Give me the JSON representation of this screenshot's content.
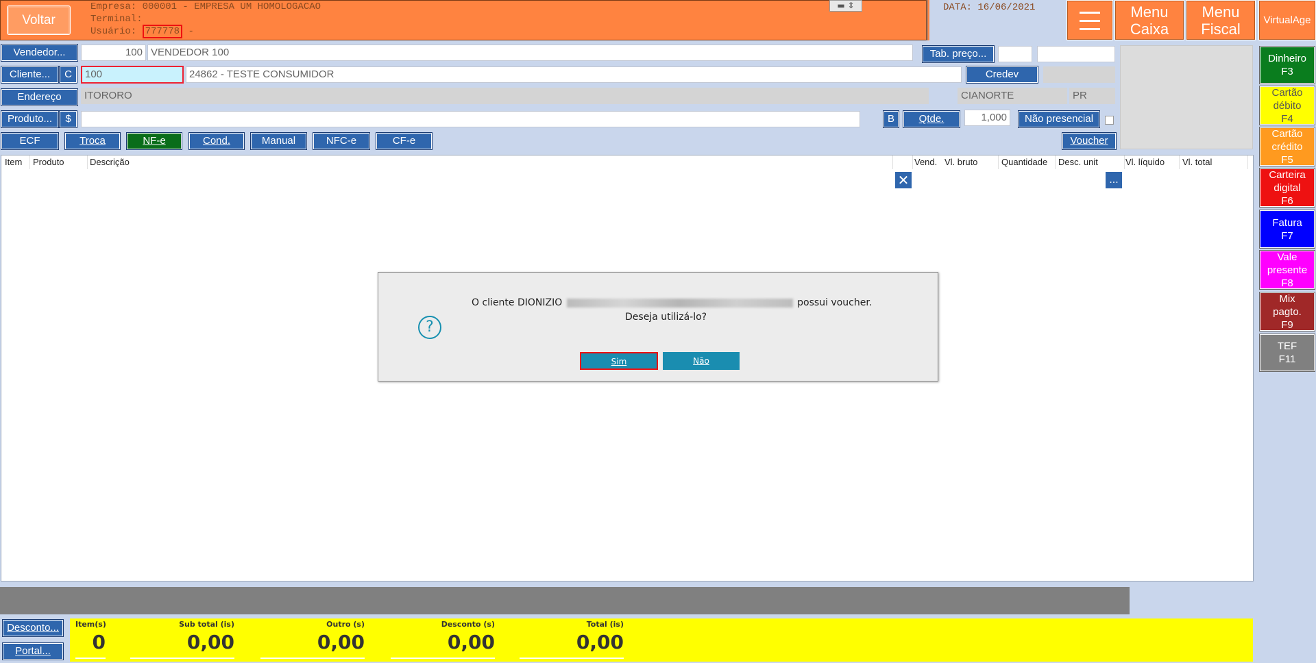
{
  "header": {
    "back_label": "Voltar",
    "empresa": "Empresa: 000001 - EMPRESA UM HOMOLOGACAO",
    "terminal": "Terminal:",
    "usuario_prefix": "Usuário:",
    "usuario_code": "777778",
    "usuario_suffix": " -",
    "date": "DATA: 16/06/2021",
    "menu_icon": "hamburger-icon",
    "menu_caixa": "Menu\nCaixa",
    "menu_fiscal": "Menu\nFiscal",
    "virtualage": "VirtualAge"
  },
  "form": {
    "vendedor_label": "Vendedor...",
    "vendedor_code": "100",
    "vendedor_name": "VENDEDOR 100",
    "tab_preco_label": "Tab. preço...",
    "tab_preco_value": "",
    "tab_preco_desc": "",
    "cliente_label": "Cliente...",
    "cliente_c_label": "C",
    "cliente_code": "100",
    "cliente_name": "24862 - TESTE CONSUMIDOR",
    "credev_label": "Credev",
    "credev_value": "",
    "endereco_label": "Endereço",
    "endereco_value": "ITORORO",
    "cidade": "CIANORTE",
    "uf": "PR",
    "produto_label": "Produto...",
    "produto_dollar_label": "$",
    "produto_value": "",
    "b_label": "B",
    "qtde_label": "Qtde.",
    "qtde_value": "1,000",
    "nao_presencial_label": "Não presencial"
  },
  "doc_tabs": [
    "ECF",
    "Troca",
    "NF-e",
    "Cond.",
    "Manual",
    "NFC-e",
    "CF-e"
  ],
  "voucher_label": "Voucher",
  "grid": {
    "columns": [
      "Item",
      "Produto",
      "Descrição",
      "Vend.",
      "Vl. bruto",
      "Quantidade",
      "Desc. unit",
      "Vl. líquido",
      "Vl. total"
    ],
    "close_icon": "close-icon",
    "more_label": "..."
  },
  "payments": [
    {
      "label": "Dinheiro\nF3",
      "bg": "#0a7d1e",
      "fg": "#ffffff"
    },
    {
      "label": "Cartão\ndébito\nF4",
      "bg": "#ffff00",
      "fg": "#555555"
    },
    {
      "label": "Cartão\ncrédito\nF5",
      "bg": "#ff9a1f",
      "fg": "#ffffff"
    },
    {
      "label": "Carteira\ndigital\nF6",
      "bg": "#ee1111",
      "fg": "#ffffff"
    },
    {
      "label": "Fatura\nF7",
      "bg": "#0000ff",
      "fg": "#ffffff"
    },
    {
      "label": "Vale\npresente\nF8",
      "bg": "#ff00ff",
      "fg": "#ffffff"
    },
    {
      "label": "Mix\npagto.\nF9",
      "bg": "#a02828",
      "fg": "#ffffff"
    },
    {
      "label": "TEF\nF11",
      "bg": "#808080",
      "fg": "#ffffff"
    }
  ],
  "dialog": {
    "icon": "question-icon",
    "message_prefix": "O cliente DIONIZIO",
    "message_suffix": "possui voucher.",
    "message_line2": "Deseja utilizá-lo?",
    "yes_label": "Sim",
    "no_label": "Não"
  },
  "footer": {
    "desconto_label": "Desconto...",
    "portal_label": "Portal...",
    "totals": [
      {
        "label": "Item(s)",
        "value": "0"
      },
      {
        "label": "Sub total (is)",
        "value": "0,00"
      },
      {
        "label": "Outro (s)",
        "value": "0,00"
      },
      {
        "label": "Desconto (s)",
        "value": "0,00"
      },
      {
        "label": "Total (is)",
        "value": "0,00"
      }
    ]
  },
  "colors": {
    "header_orange": "#ff8340",
    "button_blue": "#2f66ad",
    "totals_yellow": "#ffff00",
    "dialog_button": "#1a8db0"
  }
}
